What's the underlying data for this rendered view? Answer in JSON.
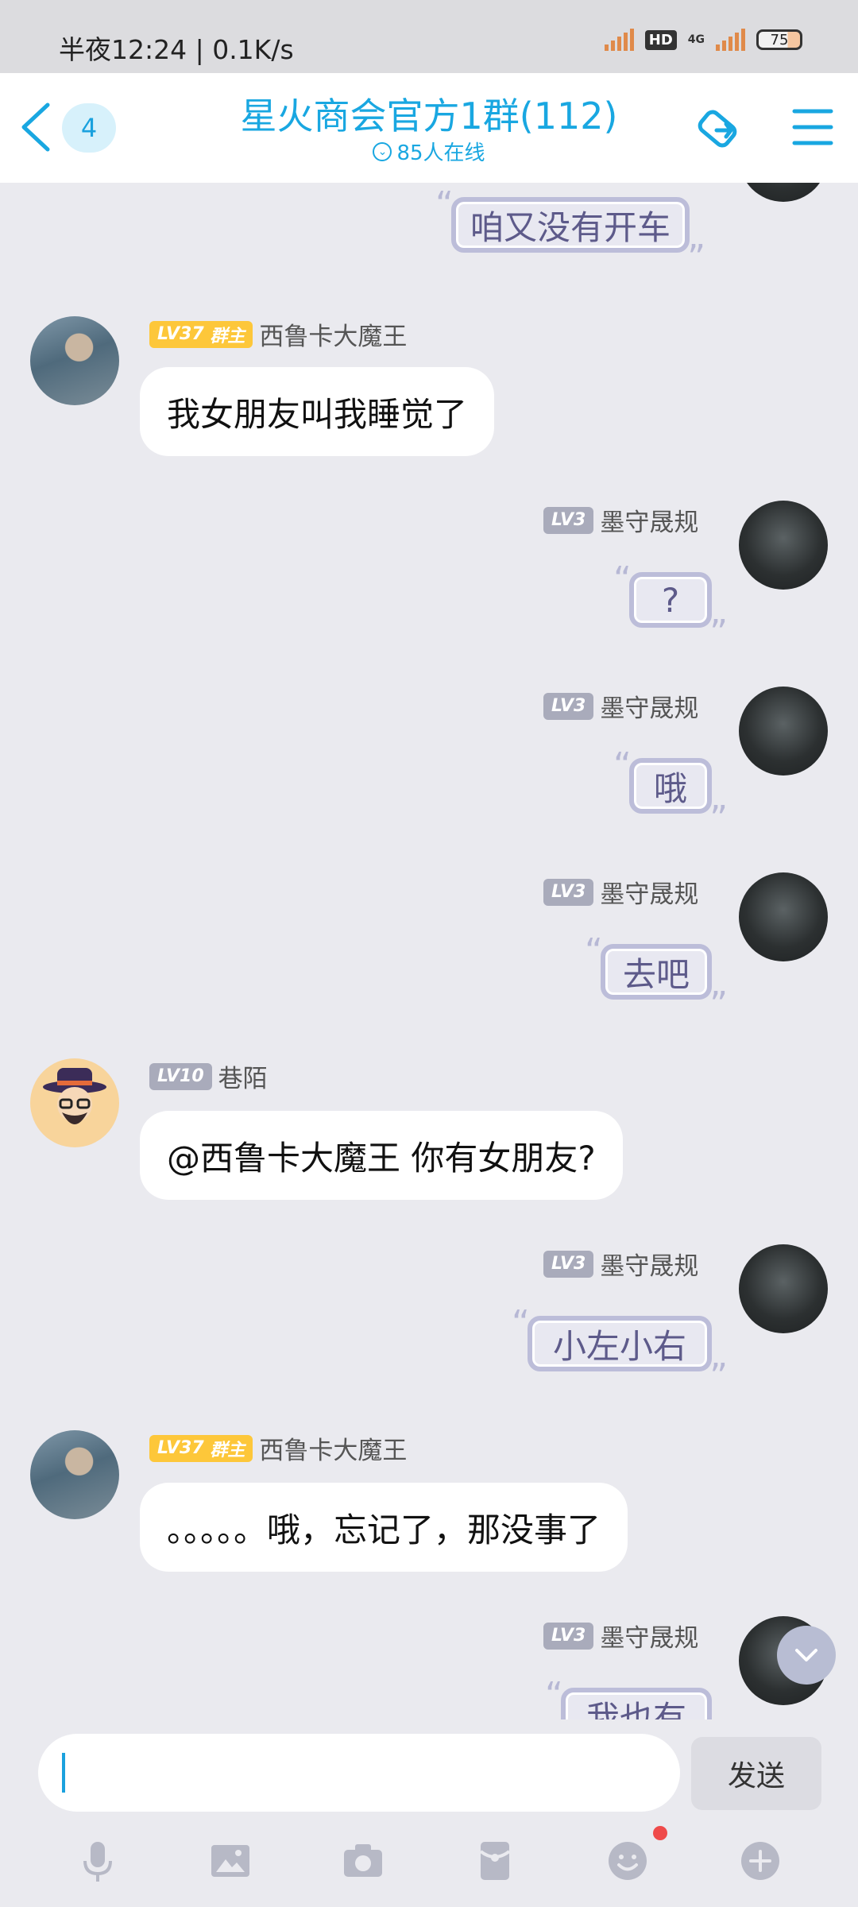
{
  "status": {
    "time": "半夜12:24 | 0.1K/s",
    "hd": "HD",
    "net": "4G",
    "battery": "75"
  },
  "header": {
    "unread": "4",
    "title": "星火商会官方1群(112)",
    "online": "85人在线"
  },
  "messages": [
    {
      "side": "right",
      "text": "咱又没有开车"
    },
    {
      "side": "left",
      "level": "LV37",
      "role": "群主",
      "name": "西鲁卡大魔王",
      "text": "我女朋友叫我睡觉了"
    },
    {
      "side": "right",
      "level": "LV3",
      "name": "墨守晟规",
      "text": "?"
    },
    {
      "side": "right",
      "level": "LV3",
      "name": "墨守晟规",
      "text": "哦"
    },
    {
      "side": "right",
      "level": "LV3",
      "name": "墨守晟规",
      "text": "去吧"
    },
    {
      "side": "left",
      "level": "LV10",
      "name": "巷陌",
      "text": "@西鲁卡大魔王 你有女朋友?"
    },
    {
      "side": "right",
      "level": "LV3",
      "name": "墨守晟规",
      "text": "小左小右"
    },
    {
      "side": "left",
      "level": "LV37",
      "role": "群主",
      "name": "西鲁卡大魔王",
      "text": "。。。。。哦，忘记了，那没事了"
    },
    {
      "side": "right",
      "level": "LV3",
      "name": "墨守晟规",
      "text": "我也有"
    }
  ],
  "input": {
    "send_label": "发送"
  },
  "toolbar": {
    "icons": [
      "microphone-icon",
      "image-icon",
      "camera-icon",
      "red-packet-icon",
      "emoji-icon",
      "plus-icon"
    ]
  },
  "colors": {
    "accent": "#19a7e1",
    "level_gold": "#fdc73a",
    "level_gray": "#a9abbb",
    "bubble_border": "#bcbdd9"
  }
}
